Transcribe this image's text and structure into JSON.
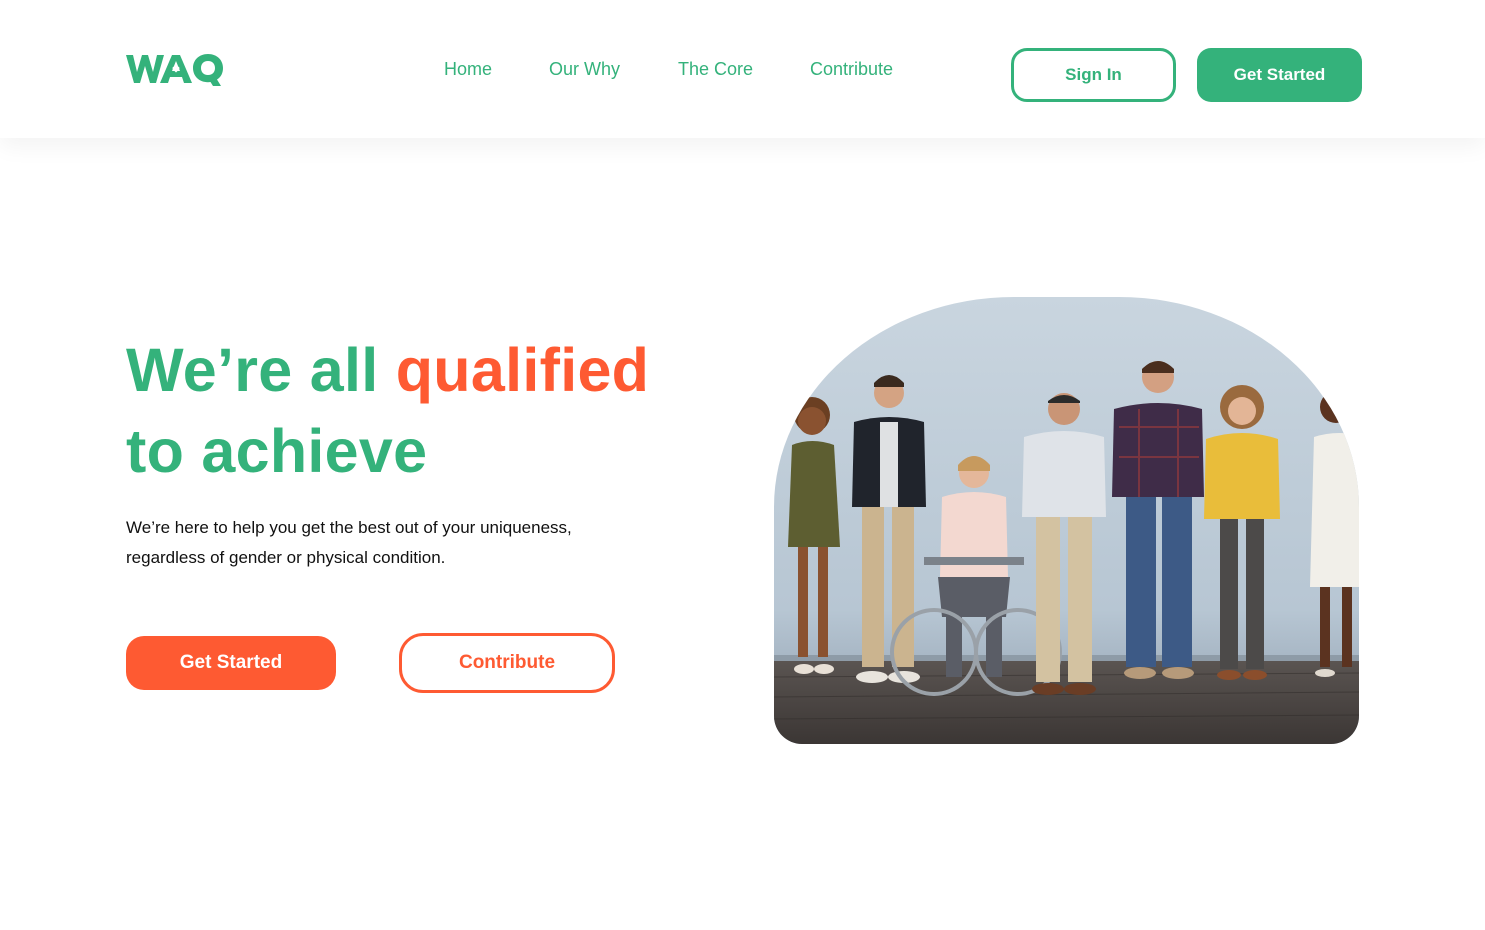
{
  "brand": {
    "logo_text": "WAQ",
    "primary_color": "#34b27b",
    "accent_color": "#fe5a32"
  },
  "nav": {
    "items": [
      {
        "label": "Home"
      },
      {
        "label": "Our Why"
      },
      {
        "label": "The Core"
      },
      {
        "label": "Contribute"
      }
    ]
  },
  "header_actions": {
    "sign_in": "Sign In",
    "get_started": "Get Started"
  },
  "hero": {
    "title_part1": "We’re all ",
    "title_accent": "qualified",
    "title_part2": "to achieve",
    "description": "We’re here to help you get the best out of your uniqueness, regardless of gender or physical condition.",
    "primary_cta": "Get Started",
    "secondary_cta": "Contribute",
    "image_subject": "group-of-diverse-people-standing-against-wall"
  }
}
